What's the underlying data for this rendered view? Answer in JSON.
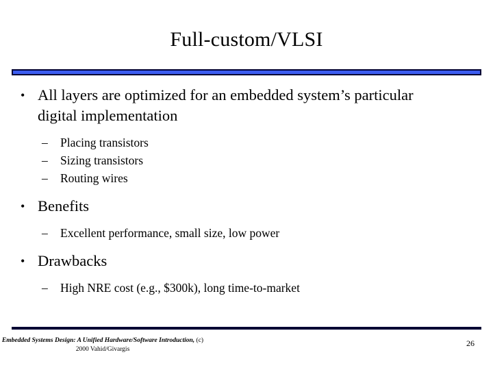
{
  "slide": {
    "title": "Full-custom/VLSI",
    "accent_color": "#3c5cf0",
    "accent_border_color": "#000033",
    "background_color": "#ffffff",
    "bullet_marker": "•",
    "sub_bullet_marker": "–",
    "content": [
      {
        "level1": "All layers are optimized for an embedded system’s particular digital implementation",
        "level2": [
          "Placing transistors",
          "Sizing transistors",
          "Routing wires"
        ]
      },
      {
        "level1": "Benefits",
        "level2": [
          "Excellent performance, small size, low power"
        ]
      },
      {
        "level1": "Drawbacks",
        "level2": [
          "High NRE cost (e.g., $300k), long time-to-market"
        ]
      }
    ]
  },
  "footer": {
    "citation_italic": "Embedded Systems Design: A Unified Hardware/Software Introduction,",
    "citation_plain": "(c) 2000 Vahid/Givargis",
    "page_number": "26"
  }
}
